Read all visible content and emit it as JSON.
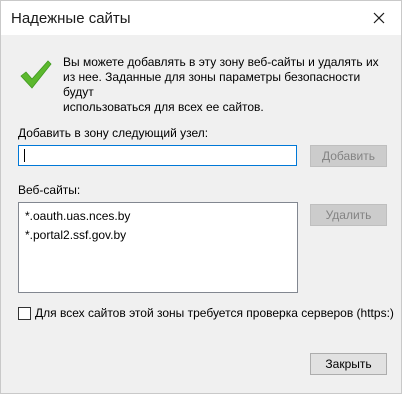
{
  "window": {
    "title": "Надежные сайты",
    "close_icon": "close-icon"
  },
  "info": {
    "icon": "checkmark-icon",
    "text": "Вы можете добавлять в эту зону  веб-сайты и удалять их\nиз нее. Заданные для зоны параметры безопасности будут\nиспользоваться для всех ее сайтов."
  },
  "add_site": {
    "label": "Добавить в зону следующий узел:",
    "value": "",
    "button_label": "Добавить",
    "button_enabled": false
  },
  "websites": {
    "label": "Веб-сайты:",
    "items": [
      "*.oauth.uas.nces.by",
      "*.portal2.ssf.gov.by"
    ],
    "remove_label": "Удалить",
    "remove_enabled": false
  },
  "https_check": {
    "label": "Для всех сайтов этой зоны требуется проверка серверов (https:)",
    "checked": false
  },
  "close_button_label": "Закрыть",
  "colors": {
    "accent": "#0078d7",
    "check_green": "#5cb82e"
  }
}
